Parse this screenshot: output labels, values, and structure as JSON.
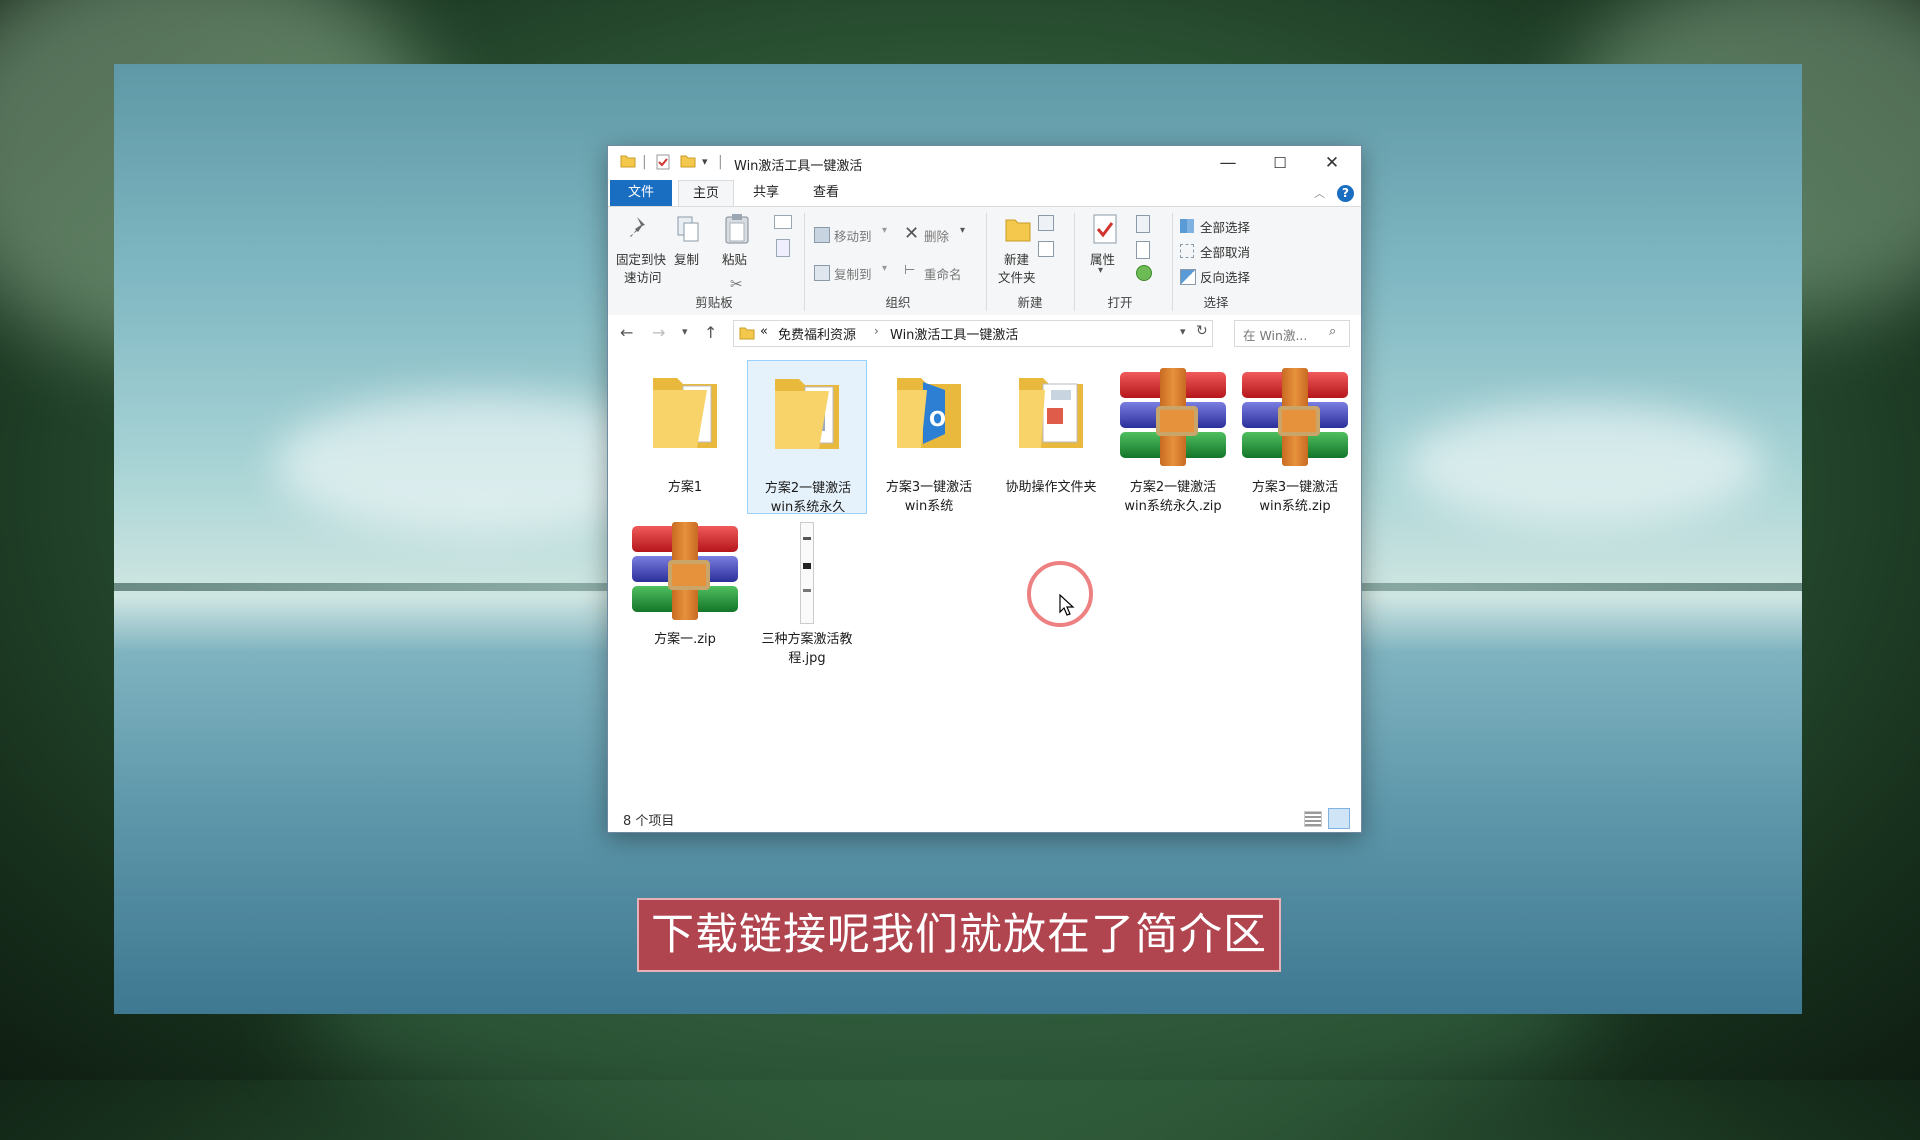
{
  "window": {
    "title": "Win激活工具一键激活",
    "controls": {
      "minimize": "—",
      "maximize": "☐",
      "close": "✕"
    }
  },
  "ribbon_tabs": [
    "文件",
    "主页",
    "共享",
    "查看"
  ],
  "ribbon": {
    "clipboard": {
      "pin_line1": "固定到快",
      "pin_line2": "速访问",
      "copy": "复制",
      "paste": "粘贴",
      "group": "剪贴板"
    },
    "organize": {
      "move_to": "移动到",
      "copy_to": "复制到",
      "delete": "删除",
      "rename": "重命名",
      "group": "组织"
    },
    "new": {
      "new_folder_line1": "新建",
      "new_folder_line2": "文件夹",
      "group": "新建"
    },
    "open": {
      "properties": "属性",
      "group": "打开"
    },
    "select": {
      "select_all": "全部选择",
      "select_none": "全部取消",
      "invert": "反向选择",
      "group": "选择"
    },
    "help": "?"
  },
  "address": {
    "crumb_prefix": "«",
    "crumbs": [
      "免费福利资源",
      "Win激活工具一键激活"
    ],
    "search_placeholder": "在 Win激..."
  },
  "files": [
    {
      "name_line1": "方案1",
      "name_line2": "",
      "type": "folder"
    },
    {
      "name_line1": "方案2一键激活",
      "name_line2": "win系统永久",
      "type": "folder"
    },
    {
      "name_line1": "方案3一键激活",
      "name_line2": "win系统",
      "type": "folder"
    },
    {
      "name_line1": "协助操作文件夹",
      "name_line2": "",
      "type": "folder"
    },
    {
      "name_line1": "方案2一键激活",
      "name_line2": "win系统永久.zip",
      "type": "zip"
    },
    {
      "name_line1": "方案3一键激活",
      "name_line2": "win系统.zip",
      "type": "zip"
    },
    {
      "name_line1": "方案一.zip",
      "name_line2": "",
      "type": "zip"
    },
    {
      "name_line1": "三种方案激活教",
      "name_line2": "程.jpg",
      "type": "image"
    }
  ],
  "status": {
    "item_count": "8 个项目"
  },
  "subtitle": "下载链接呢我们就放在了简介区",
  "colors": {
    "accent": "#1a6ec2",
    "subtitle_bg": "#b04550",
    "cursor_ring": "#e86060"
  }
}
